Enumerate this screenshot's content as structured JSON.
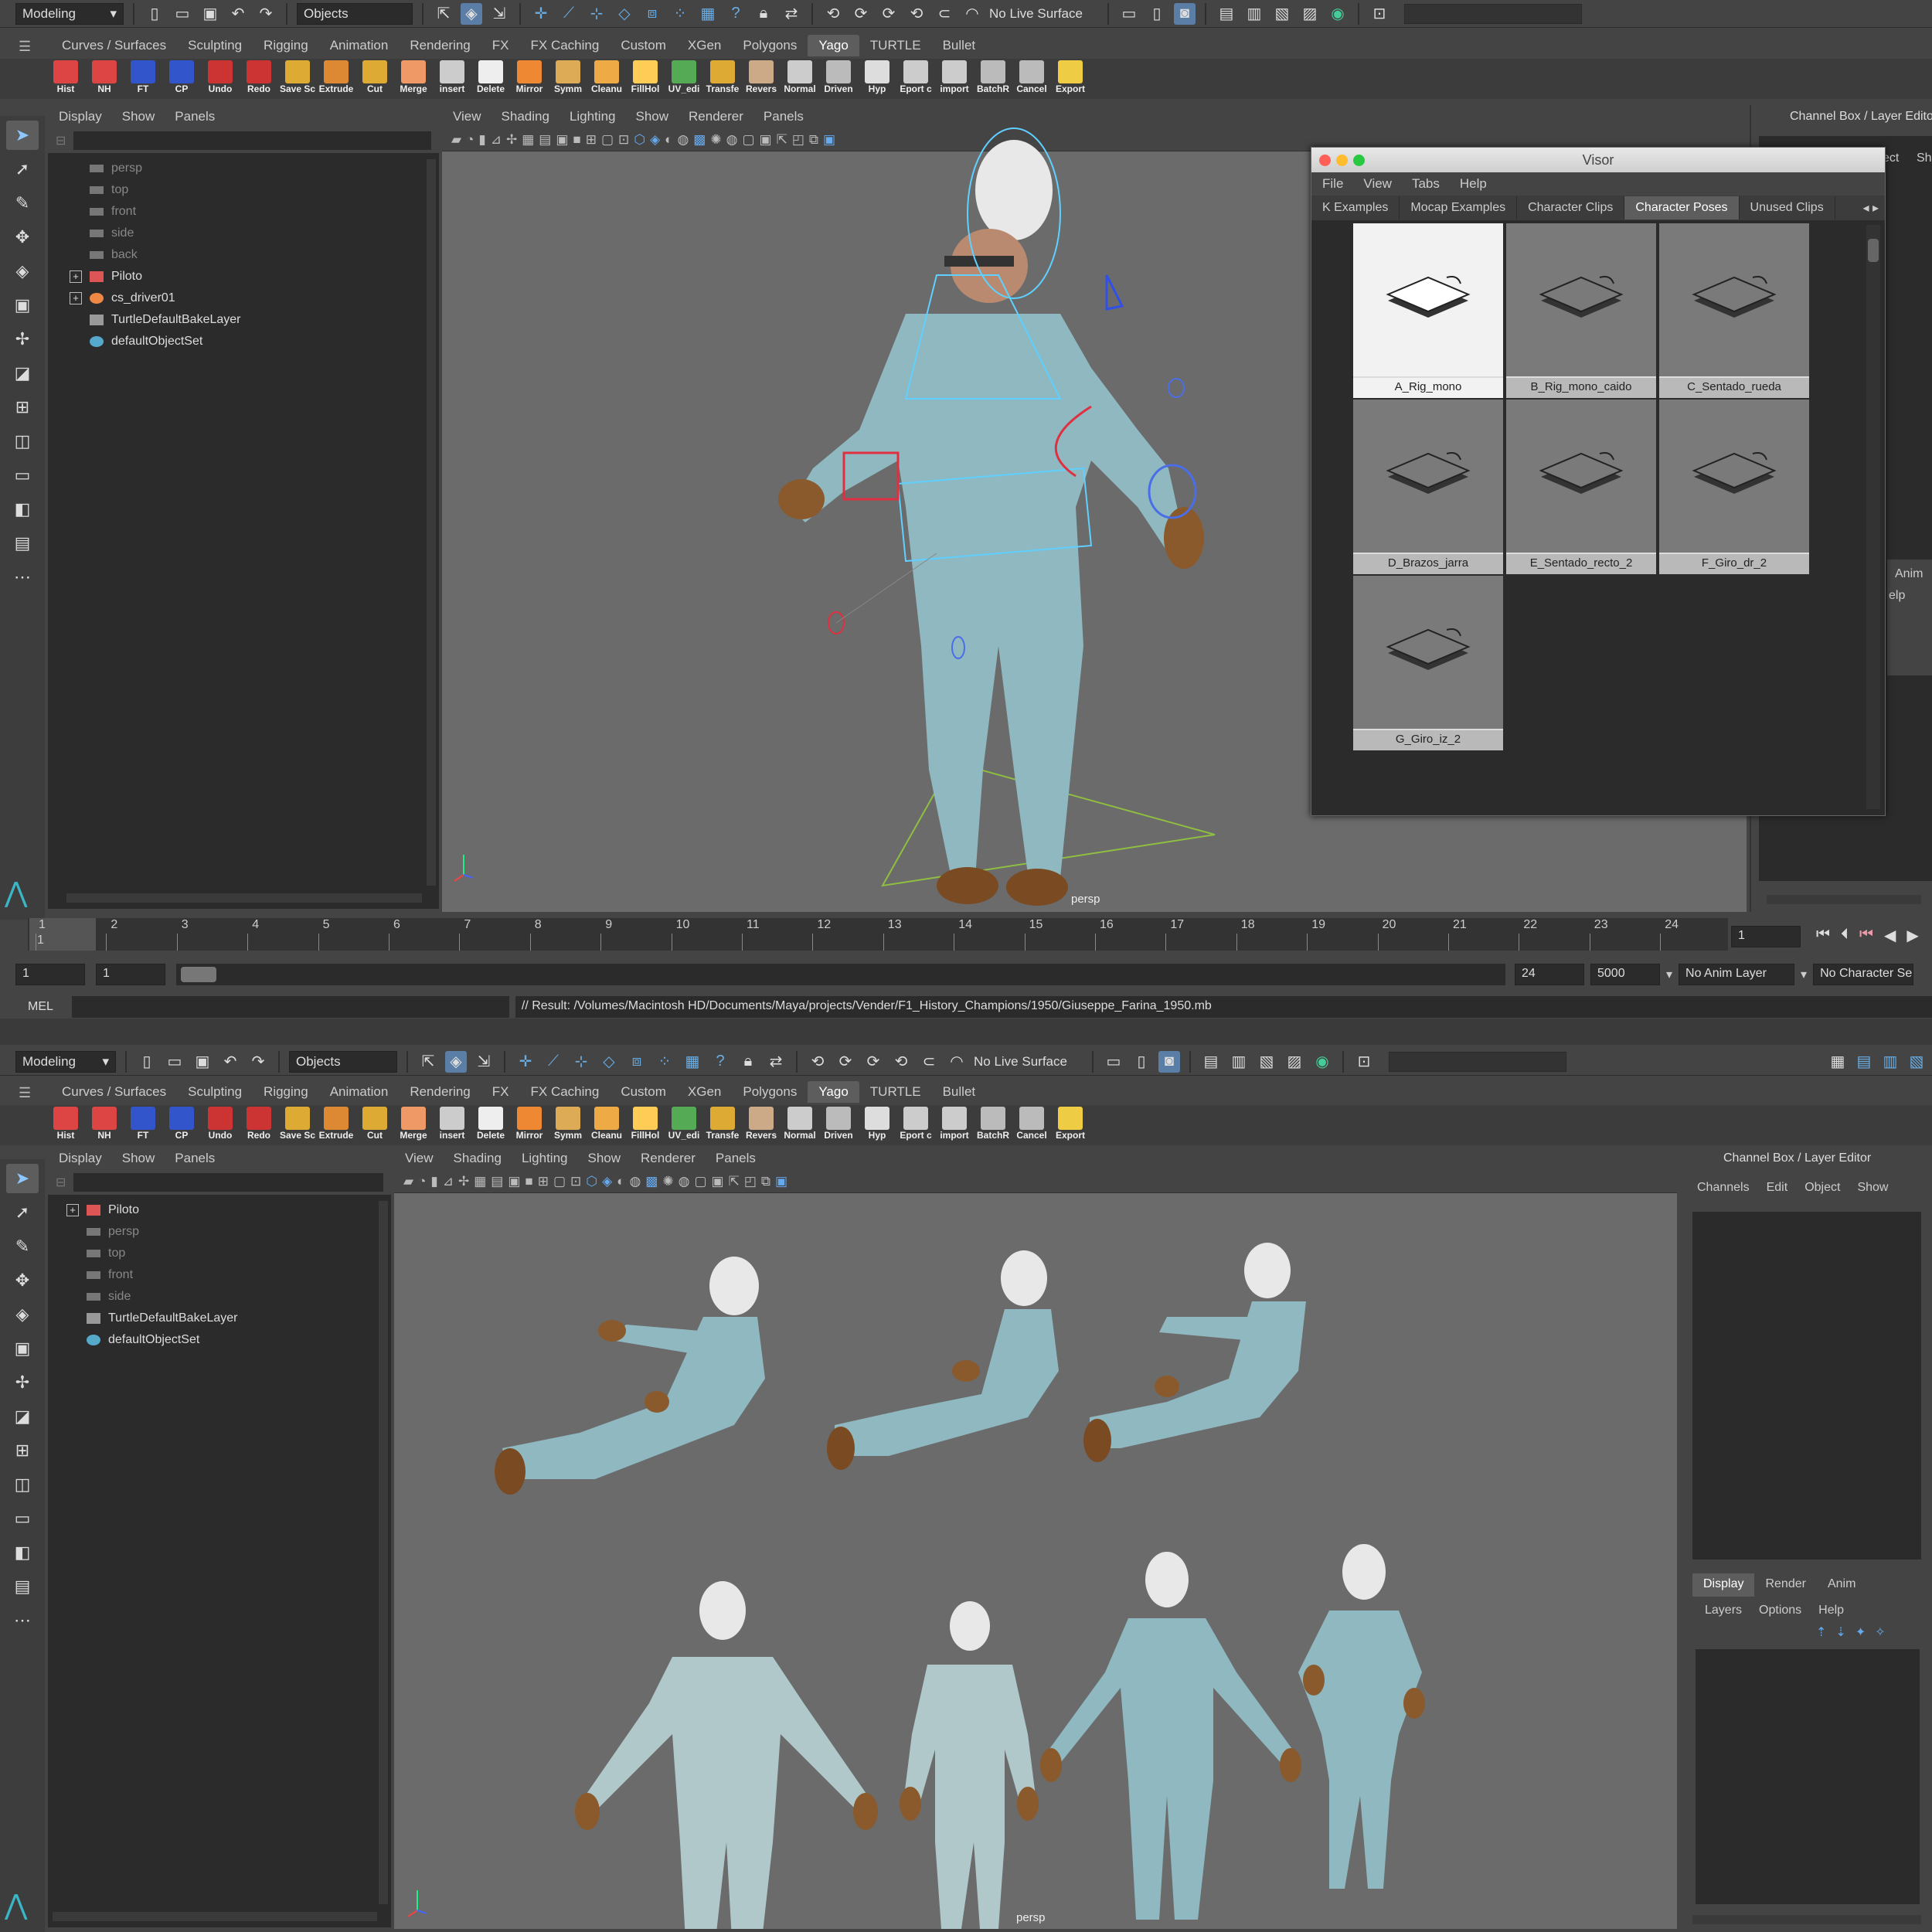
{
  "top_window": {
    "status_line": {
      "menu_set": "Modeling",
      "selection_mode": "Objects",
      "live_surface": "No Live Surface"
    },
    "shelf_tabs": [
      "Curves / Surfaces",
      "Sculpting",
      "Rigging",
      "Animation",
      "Rendering",
      "FX",
      "FX Caching",
      "Custom",
      "XGen",
      "Polygons",
      "Yago",
      "TURTLE",
      "Bullet"
    ],
    "active_shelf": "Yago",
    "shelf_tools": [
      "Hist",
      "NH",
      "FT",
      "CP",
      "Undo",
      "Redo",
      "Save Sc",
      "Extrude",
      "Cut",
      "Merge",
      "insert",
      "Delete",
      "Mirror",
      "Symm",
      "Cleanu",
      "FillHol",
      "UV_edi",
      "Transfe",
      "Revers",
      "Normal",
      "Driven",
      "Hyp",
      "Eport c",
      "import",
      "BatchR",
      "Cancel",
      "Export"
    ],
    "outliner": {
      "menu": [
        "Display",
        "Show",
        "Panels"
      ],
      "items": [
        {
          "label": "persp",
          "dim": true
        },
        {
          "label": "top",
          "dim": true
        },
        {
          "label": "front",
          "dim": true
        },
        {
          "label": "side",
          "dim": true
        },
        {
          "label": "back",
          "dim": true
        },
        {
          "label": "Piloto",
          "dim": false
        },
        {
          "label": "cs_driver01",
          "dim": false
        },
        {
          "label": "TurtleDefaultBakeLayer",
          "dim": false
        },
        {
          "label": "defaultObjectSet",
          "dim": false
        }
      ]
    },
    "viewport": {
      "menu": [
        "View",
        "Shading",
        "Lighting",
        "Show",
        "Renderer",
        "Panels"
      ],
      "camera": "persp"
    },
    "visor": {
      "title": "Visor",
      "menu": [
        "File",
        "View",
        "Tabs",
        "Help"
      ],
      "tabs": [
        "K Examples",
        "Mocap Examples",
        "Character Clips",
        "Character Poses",
        "Unused Clips"
      ],
      "active_tab": "Character Poses",
      "poses": [
        "A_Rig_mono",
        "B_Rig_mono_caido",
        "C_Sentado_rueda",
        "D_Brazos_jarra",
        "E_Sentado_recto_2",
        "F_Giro_dr_2",
        "G_Giro_iz_2"
      ]
    },
    "channel_box_title": "Channel Box / Layer Editor",
    "side_clipped": {
      "a": "ect",
      "b": "Sh",
      "c": "Anim",
      "d": "elp"
    },
    "timeline": {
      "ticks": [
        "1",
        "2",
        "3",
        "4",
        "5",
        "6",
        "7",
        "8",
        "9",
        "10",
        "11",
        "12",
        "13",
        "14",
        "15",
        "16",
        "17",
        "18",
        "19",
        "20",
        "21",
        "22",
        "23",
        "24"
      ],
      "current_frame": "1",
      "frame_field": "1"
    },
    "range": {
      "start": "1",
      "inner_start": "1",
      "end": "24",
      "outer_end": "5000",
      "anim_layer": "No Anim Layer",
      "char_set": "No Character Se"
    },
    "command_line": {
      "lang": "MEL",
      "result": "// Result: /Volumes/Macintosh HD/Documents/Maya/projects/Vender/F1_History_Champions/1950/Giuseppe_Farina_1950.mb"
    }
  },
  "bottom_window": {
    "status_line": {
      "menu_set": "Modeling",
      "selection_mode": "Objects",
      "live_surface": "No Live Surface"
    },
    "shelf_tabs": [
      "Curves / Surfaces",
      "Sculpting",
      "Rigging",
      "Animation",
      "Rendering",
      "FX",
      "FX Caching",
      "Custom",
      "XGen",
      "Polygons",
      "Yago",
      "TURTLE",
      "Bullet"
    ],
    "active_shelf": "Yago",
    "shelf_tools": [
      "Hist",
      "NH",
      "FT",
      "CP",
      "Undo",
      "Redo",
      "Save Sc",
      "Extrude",
      "Cut",
      "Merge",
      "insert",
      "Delete",
      "Mirror",
      "Symm",
      "Cleanu",
      "FillHol",
      "UV_edi",
      "Transfe",
      "Revers",
      "Normal",
      "Driven",
      "Hyp",
      "Eport c",
      "import",
      "BatchR",
      "Cancel",
      "Export"
    ],
    "outliner": {
      "menu": [
        "Display",
        "Show",
        "Panels"
      ],
      "items": [
        {
          "label": "Piloto",
          "dim": false
        },
        {
          "label": "persp",
          "dim": true
        },
        {
          "label": "top",
          "dim": true
        },
        {
          "label": "front",
          "dim": true
        },
        {
          "label": "side",
          "dim": true
        },
        {
          "label": "TurtleDefaultBakeLayer",
          "dim": false
        },
        {
          "label": "defaultObjectSet",
          "dim": false
        }
      ]
    },
    "viewport": {
      "menu": [
        "View",
        "Shading",
        "Lighting",
        "Show",
        "Renderer",
        "Panels"
      ],
      "camera": "persp"
    },
    "channel_box": {
      "title": "Channel Box / Layer Editor",
      "menu": [
        "Channels",
        "Edit",
        "Object",
        "Show"
      ],
      "layer_tabs": [
        "Display",
        "Render",
        "Anim"
      ],
      "active_layer_tab": "Display",
      "layer_menu": [
        "Layers",
        "Options",
        "Help"
      ]
    }
  },
  "colors": {
    "accent": "#5a7ea6",
    "suit": "#8fb8c0",
    "skin": "#c79a80",
    "glove": "#8a5a2c",
    "rig_cyan": "#5fd0ff",
    "rig_red": "#e03040",
    "viewport_bg": "#6b6b6b"
  }
}
